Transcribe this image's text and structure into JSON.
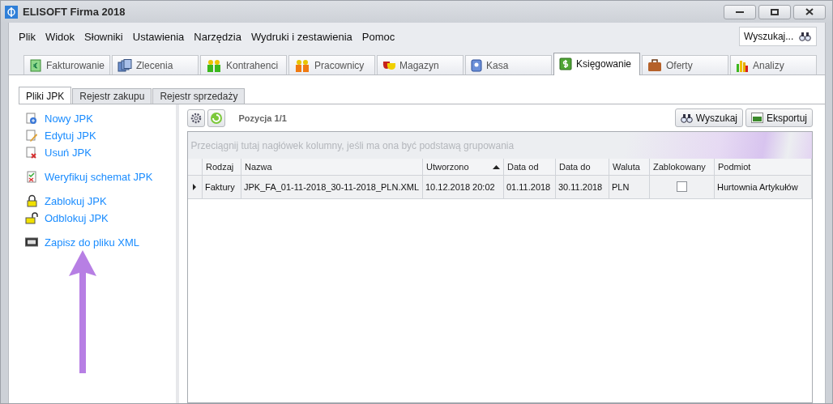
{
  "window": {
    "title": "ELISOFT Firma 2018"
  },
  "menu": [
    "Plik",
    "Widok",
    "Słowniki",
    "Ustawienia",
    "Narzędzia",
    "Wydruki i zestawienia",
    "Pomoc"
  ],
  "search": {
    "placeholder": "Wyszukaj..."
  },
  "modules": [
    {
      "label": "Fakturowanie",
      "selected": false
    },
    {
      "label": "Zlecenia",
      "selected": false
    },
    {
      "label": "Kontrahenci",
      "selected": false
    },
    {
      "label": "Pracownicy",
      "selected": false
    },
    {
      "label": "Magazyn",
      "selected": false
    },
    {
      "label": "Kasa",
      "selected": false
    },
    {
      "label": "Księgowanie",
      "selected": true
    },
    {
      "label": "Oferty",
      "selected": false
    },
    {
      "label": "Analizy",
      "selected": false
    }
  ],
  "subtabs": [
    {
      "label": "Pliki JPK",
      "selected": true
    },
    {
      "label": "Rejestr zakupu",
      "selected": false
    },
    {
      "label": "Rejestr sprzedaży",
      "selected": false
    }
  ],
  "action_groups": [
    [
      "Nowy JPK",
      "Edytuj JPK",
      "Usuń JPK"
    ],
    [
      "Weryfikuj schemat JPK"
    ],
    [
      "Zablokuj JPK",
      "Odblokuj JPK"
    ],
    [
      "Zapisz do pliku XML"
    ]
  ],
  "toolbar": {
    "position": "Pozycja 1/1",
    "buttons": [
      "Wyszukaj",
      "Eksportuj"
    ]
  },
  "group_hint": "Przeciągnij tutaj nagłówek kolumny, jeśli ma ona być podstawą grupowania",
  "table": {
    "columns": [
      {
        "label": "Rodzaj",
        "sorted": false
      },
      {
        "label": "Nazwa",
        "sorted": false
      },
      {
        "label": "Utworzono",
        "sorted": true
      },
      {
        "label": "Data od",
        "sorted": false
      },
      {
        "label": "Data do",
        "sorted": false
      },
      {
        "label": "Waluta",
        "sorted": false
      },
      {
        "label": "Zablokowany",
        "sorted": false
      },
      {
        "label": "Podmiot",
        "sorted": false
      }
    ],
    "rows": [
      {
        "selected": true,
        "rodzaj": "Faktury",
        "nazwa": "JPK_FA_01-11-2018_30-11-2018_PLN.XML",
        "utworzono": "10.12.2018 20:02",
        "data_od": "01.11.2018",
        "data_do": "30.11.2018",
        "waluta": "PLN",
        "zablokowany": false,
        "podmiot": "Hurtownia Artykułów"
      }
    ]
  },
  "annotation": {
    "kind": "arrow"
  }
}
